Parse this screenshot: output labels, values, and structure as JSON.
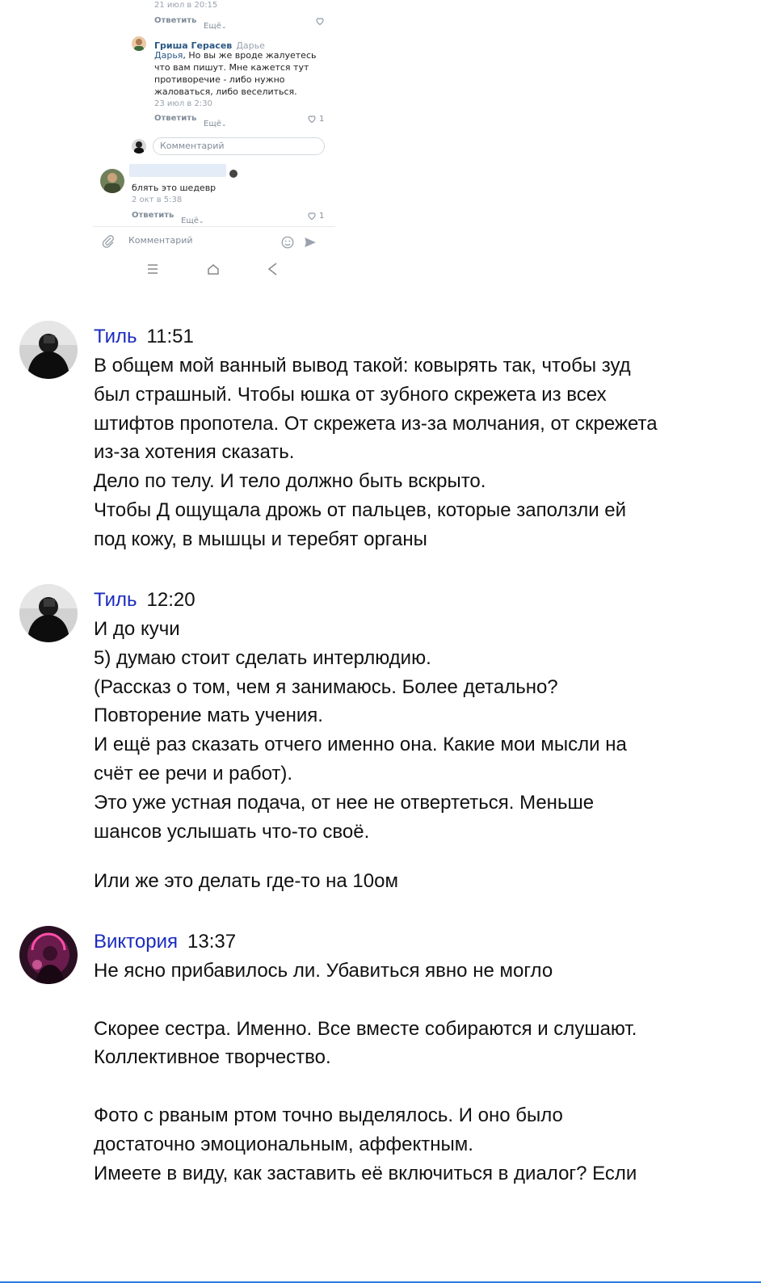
{
  "screenshot": {
    "comment1": {
      "date": "21 июл в 20:15",
      "reply": "Ответить",
      "more": "Ещё"
    },
    "comment2": {
      "author": "Гриша Герасев",
      "reply_to": "Дарье",
      "mention": "Дарья",
      "text": ", Но вы же вроде жалуетесь что вам пишут. Мне кажется тут противоречие - либо нужно жаловаться, либо веселиться.",
      "date": "23 июл в 2:30",
      "reply": "Ответить",
      "more": "Ещё",
      "likes": "1"
    },
    "reply_input_placeholder": "Комментарий",
    "comment3": {
      "text": "блять это шедевр",
      "date": "2 окт в 5:38",
      "reply": "Ответить",
      "more": "Ещё",
      "likes": "1"
    },
    "bottom_input_placeholder": "Комментарий"
  },
  "messages": [
    {
      "name": "Тиль",
      "time": "11:51",
      "lines": [
        "В общем мой ванный вывод такой: ковырять так, чтобы зуд",
        "был страшный. Чтобы юшка от зубного скрежета из всех",
        "штифтов пропотела. От скрежета из-за молчания, от скрежета",
        "из-за хотения сказать.",
        "Дело по телу. И тело должно быть вскрыто.",
        "Чтобы Д ощущала дрожь от пальцев, которые заползли ей",
        "под кожу, в мышцы и теребят органы"
      ]
    },
    {
      "name": "Тиль",
      "time": "12:20",
      "lines": [
        "И до кучи",
        "5) думаю стоит сделать интерлюдию.",
        "(Рассказ о том, чем я занимаюсь. Более детально?",
        "Повторение мать учения.",
        "И ещё раз сказать отчего именно она. Какие мои мысли на",
        "счёт ее речи и работ).",
        "Это уже устная подача, от нее не отвертеться. Меньше",
        "шансов услышать что-то своё."
      ],
      "tail": "Или же это делать где-то на 10ом"
    },
    {
      "name": "Виктория",
      "time": "13:37",
      "para1": "Не ясно прибавилось ли. Убавиться явно не могло",
      "para2": [
        "Скорее сестра. Именно. Все вместе собираются и слушают.",
        "Коллективное творчество."
      ],
      "para3": [
        "Фото с рваным ртом точно выделялось. И оно было",
        "достаточно эмоциональным, аффектным.",
        "Имеете в виду, как заставить её включиться в диалог? Если"
      ]
    }
  ],
  "colors": {
    "name_link": "#1a2bbd",
    "vk_link": "#2a5885",
    "meta": "#99a2ad",
    "accent_line": "#2c7bdc"
  }
}
